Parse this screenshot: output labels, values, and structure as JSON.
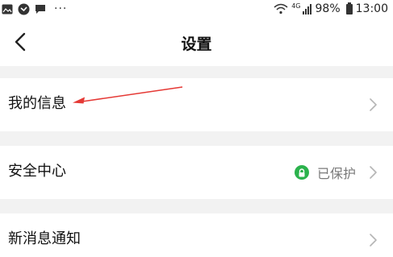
{
  "status_bar": {
    "overflow": "···",
    "network_label": "4G",
    "battery": "98%",
    "time": "13:00"
  },
  "header": {
    "title": "设置"
  },
  "rows": [
    {
      "label": "我的信息"
    },
    {
      "label": "安全中心",
      "status": "已保护"
    },
    {
      "label": "新消息通知"
    }
  ],
  "colors": {
    "accent_green": "#2bb24c",
    "annotation_red": "#e53935",
    "background": "#f2f2f2",
    "card": "#ffffff"
  },
  "icons": [
    "gallery-icon",
    "shield-app-icon",
    "chat-bubble-icon",
    "wifi-icon",
    "signal-icon",
    "battery-icon",
    "back-arrow-icon",
    "chevron-right-icon",
    "lock-icon"
  ]
}
